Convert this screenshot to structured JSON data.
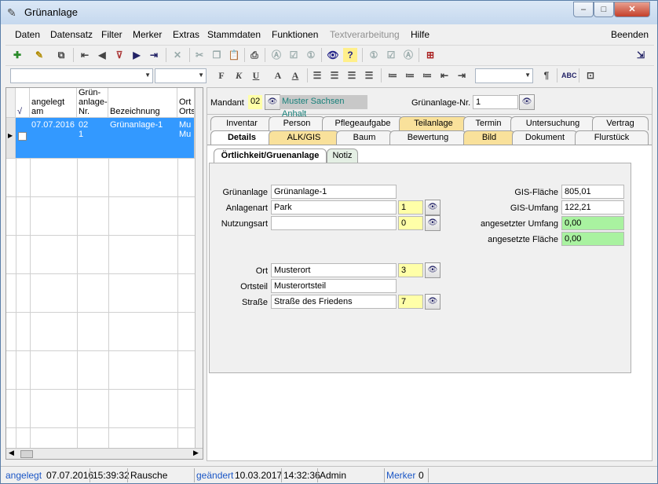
{
  "window": {
    "title": "Grünanlage",
    "minimize": "–",
    "maximize": "□",
    "close": "✕"
  },
  "menu": {
    "items": [
      "Daten",
      "Datensatz",
      "Filter",
      "Merker",
      "Extras",
      "Stammdaten",
      "Funktionen",
      "Textverarbeitung",
      "Hilfe"
    ],
    "disabled_item": "Textverarbeitung",
    "right_item": "Beenden"
  },
  "format_toolbar": {
    "bold": "F",
    "italic": "K",
    "underline": "U",
    "font_a": "A",
    "font_color_a": "A",
    "paragraph": "¶"
  },
  "grid": {
    "columns": [
      "√",
      "angelegt am",
      "Grün-anlage-Nr.",
      "Bezeichnung",
      "Ort Orts"
    ],
    "row": {
      "angelegt": "07.07.2016",
      "nr_line1": "02",
      "nr_line2": "1",
      "bezeichnung": "Grünanlage-1",
      "ort1": "Mu",
      "ort2": "Mu"
    }
  },
  "header": {
    "mandant_label": "Mandant",
    "mandant_nr": "02",
    "mandant_name": "Muster Sachsen Anhalt",
    "nr_label": "Grünanlage-Nr.",
    "nr_value": "1"
  },
  "tabs_row1": [
    "Inventar",
    "Person",
    "Pflegeaufgabe",
    "Teilanlage",
    "Termin",
    "Untersuchung",
    "Vertrag"
  ],
  "tabs_row2": [
    "Details",
    "ALK/GIS",
    "Baum",
    "Bewertung",
    "Bild",
    "Dokument",
    "Flurstück"
  ],
  "subtabs": [
    "Örtlichkeit/Gruenanlage",
    "Notiz"
  ],
  "form": {
    "gruenanlage_label": "Grünanlage",
    "gruenanlage_value": "Grünanlage-1",
    "anlagenart_label": "Anlagenart",
    "anlagenart_value": "Park",
    "anlagenart_code": "1",
    "nutzungsart_label": "Nutzungsart",
    "nutzungsart_value": "",
    "nutzungsart_code": "0",
    "ort_label": "Ort",
    "ort_value": "Musterort",
    "ort_code": "3",
    "ortsteil_label": "Ortsteil",
    "ortsteil_value": "Musterortsteil",
    "strasse_label": "Straße",
    "strasse_value": "Straße des Friedens",
    "strasse_code": "7",
    "gis_flaeche_label": "GIS-Fläche",
    "gis_flaeche_value": "805,01",
    "gis_umfang_label": "GIS-Umfang",
    "gis_umfang_value": "122,21",
    "ang_umfang_label": "angesetzter Umfang",
    "ang_umfang_value": "0,00",
    "ang_flaeche_label": "angesetzte Fläche",
    "ang_flaeche_value": "0,00"
  },
  "status": {
    "angelegt_label": "angelegt",
    "angelegt_date": "07.07.2016",
    "angelegt_time": "15:39:32",
    "angelegt_user": "Rausche",
    "geaendert_label": "geändert",
    "geaendert_date": "10.03.2017",
    "geaendert_time": "14:32:36",
    "geaendert_user": "Admin",
    "merker_label": "Merker",
    "merker_value": "0"
  },
  "colors": {
    "selection": "#3399ff",
    "yellow_field": "#ffffa8",
    "green_field": "#a9f2a0",
    "tab_yellow": "#f9e19b",
    "status_blue": "#1a56c6"
  }
}
